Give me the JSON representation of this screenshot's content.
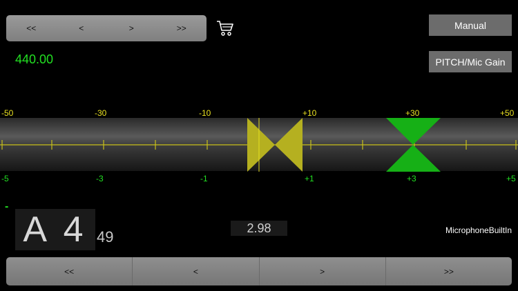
{
  "top_nav": [
    "<<",
    "<",
    ">",
    ">>"
  ],
  "frequency": "440.00",
  "buttons": {
    "manual": "Manual",
    "pitch": "PITCH/Mic Gain"
  },
  "scale_top": [
    "-50",
    "-30",
    "-10",
    "+10",
    "+30",
    "+50"
  ],
  "scale_bottom": [
    "-5",
    "-3",
    "-1",
    "+1",
    "+3",
    "+5"
  ],
  "indicator_minus": "-",
  "note": {
    "name": "A 4",
    "number": "49"
  },
  "cents": "2.98",
  "device": "MicrophoneBuiltIn",
  "bottom_nav": [
    "<<",
    "<",
    ">",
    ">>"
  ],
  "colors": {
    "accent_green": "#22e022",
    "scale_yellow": "#e8e020",
    "marker_yellow": "#b5b020",
    "marker_green": "#16b016"
  },
  "icons": {
    "cart": "cart-icon"
  }
}
